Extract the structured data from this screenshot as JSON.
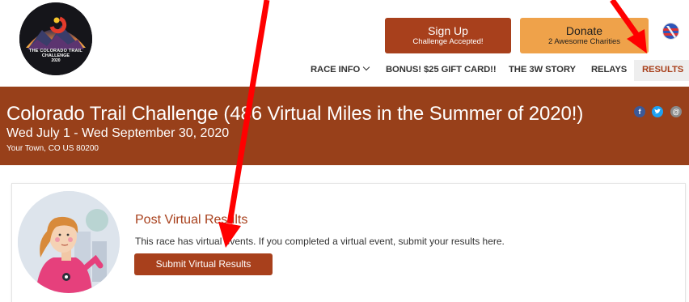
{
  "logo": {
    "line1": "THE COLORADO TRAIL",
    "line2": "CHALLENGE",
    "line3": "2020"
  },
  "header": {
    "signup": {
      "label": "Sign Up",
      "sub": "Challenge Accepted!"
    },
    "donate": {
      "label": "Donate",
      "sub": "2 Awesome Charities"
    }
  },
  "nav": {
    "items": [
      {
        "label": "RACE INFO"
      },
      {
        "label": "BONUS! $25 GIFT CARD!!"
      },
      {
        "label": "THE 3W STORY"
      },
      {
        "label": "RELAYS"
      },
      {
        "label": "RESULTS"
      }
    ]
  },
  "banner": {
    "title": "Colorado Trail Challenge (486 Virtual Miles in the Summer of 2020!)",
    "date": "Wed July 1 - Wed September 30, 2020",
    "location": "Your Town, CO US 80200",
    "social": {
      "facebook": "f",
      "twitter": "t",
      "email": "@"
    }
  },
  "virtual": {
    "title": "Post Virtual Results",
    "description": "This race has virtual events. If you completed a virtual event, submit your results here.",
    "button": "Submit Virtual Results"
  },
  "colors": {
    "brand": "#a8401c",
    "banner": "#98401a",
    "donate": "#efa24a",
    "annotation": "#ff0000"
  }
}
